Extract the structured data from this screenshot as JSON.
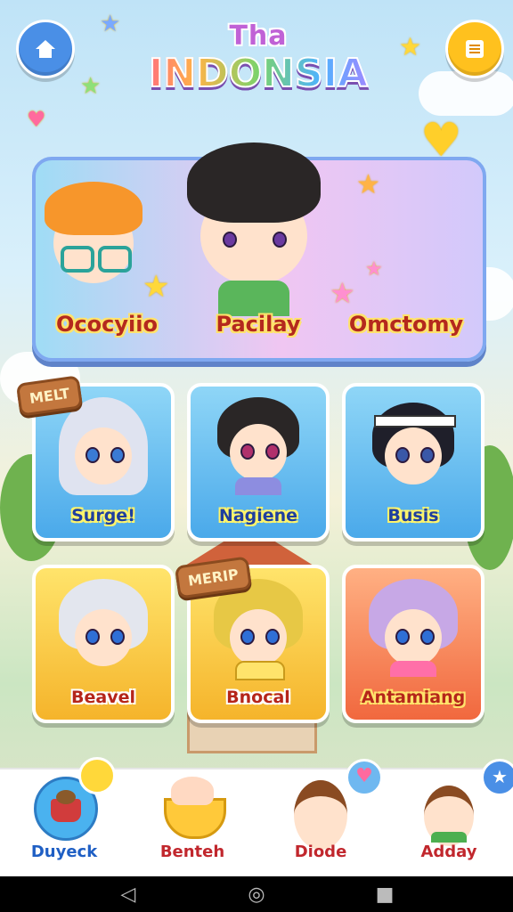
{
  "header": {
    "title_small": "Tha",
    "title_big": "INDONSIA",
    "home_icon": "home-icon",
    "menu_icon": "list-icon"
  },
  "featured": {
    "characters": [
      {
        "name": "Ococyiio"
      },
      {
        "name": "Pacilay"
      },
      {
        "name": "Omctomy"
      }
    ]
  },
  "grid": {
    "cards": [
      {
        "name": "Surge!",
        "badge": "MELT"
      },
      {
        "name": "Nagiene",
        "badge": ""
      },
      {
        "name": "Busis",
        "badge": ""
      },
      {
        "name": "Beavel",
        "badge": ""
      },
      {
        "name": "Bnocal",
        "badge": "MERIP"
      },
      {
        "name": "Antamiang",
        "badge": ""
      }
    ]
  },
  "bottom_nav": {
    "items": [
      {
        "label": "Duyeck",
        "icon": "basket-icon"
      },
      {
        "label": "Benteh",
        "icon": "food-bowl-icon"
      },
      {
        "label": "Diode",
        "icon": "character-icon"
      },
      {
        "label": "Adday",
        "icon": "character-icon"
      }
    ]
  },
  "colors": {
    "blue_card": "#4aa9ea",
    "yellow_card": "#f5b42b",
    "red_card": "#f1683e",
    "name_red": "#b4291d"
  }
}
